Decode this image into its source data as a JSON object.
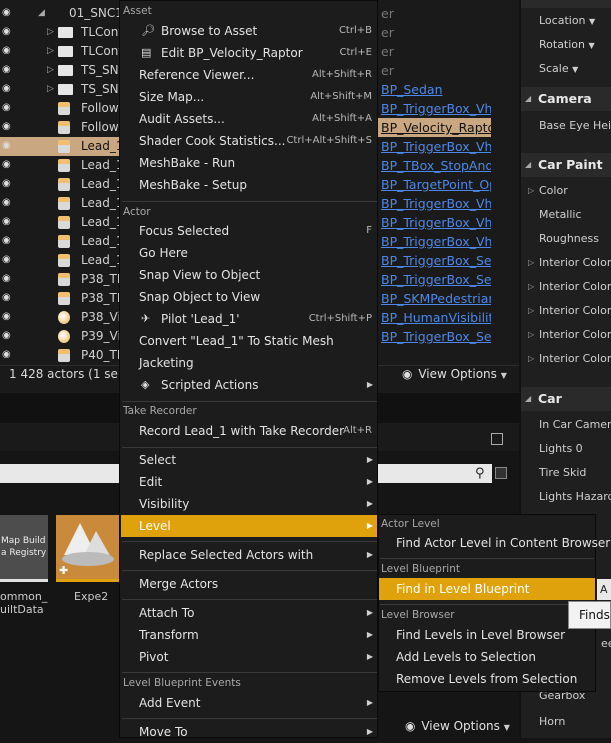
{
  "outliner": {
    "rows": [
      {
        "name": "01_SNC1",
        "kind": "folder-open"
      },
      {
        "name": "TLCont",
        "kind": "folder"
      },
      {
        "name": "TLCont",
        "kind": "folder"
      },
      {
        "name": "TS_SNC",
        "kind": "folder"
      },
      {
        "name": "TS_SNC",
        "kind": "folder"
      },
      {
        "name": "Followe",
        "kind": "actor"
      },
      {
        "name": "Followe",
        "kind": "actor"
      },
      {
        "name": "Lead_1",
        "kind": "actor",
        "selected": true
      },
      {
        "name": "Lead_1",
        "kind": "actor"
      },
      {
        "name": "Lead_1",
        "kind": "actor"
      },
      {
        "name": "Lead_1",
        "kind": "actor"
      },
      {
        "name": "Lead_1",
        "kind": "actor"
      },
      {
        "name": "Lead_1",
        "kind": "actor"
      },
      {
        "name": "Lead_1",
        "kind": "actor"
      },
      {
        "name": "P38_TE",
        "kind": "actor"
      },
      {
        "name": "P38_TE",
        "kind": "actor"
      },
      {
        "name": "P38_Vi",
        "kind": "sphere"
      },
      {
        "name": "P39_Vi",
        "kind": "sphere"
      },
      {
        "name": "P40_TE",
        "kind": "actor"
      }
    ],
    "type_column": [
      {
        "text": "er",
        "style": "gray"
      },
      {
        "text": "er",
        "style": "gray"
      },
      {
        "text": "er",
        "style": "gray"
      },
      {
        "text": "er",
        "style": "gray"
      },
      {
        "text": "BP_Sedan",
        "style": "link"
      },
      {
        "text": "BP_TriggerBox_Vhc",
        "style": "link"
      },
      {
        "text": "BP_Velocity_Raptor",
        "style": "sel"
      },
      {
        "text": "BP_TriggerBox_Vhc",
        "style": "link"
      },
      {
        "text": "BP_TBox_StopAndC",
        "style": "link"
      },
      {
        "text": "BP_TargetPoint_Op",
        "style": "link"
      },
      {
        "text": "BP_TriggerBox_Vhc",
        "style": "link"
      },
      {
        "text": "BP_TriggerBox_Vhc",
        "style": "link"
      },
      {
        "text": "BP_TriggerBox_Vhc",
        "style": "link"
      },
      {
        "text": "BP_TriggerBox_Set",
        "style": "link"
      },
      {
        "text": "BP_TriggerBox_Set",
        "style": "link"
      },
      {
        "text": "BP_SKMPedestrian",
        "style": "link"
      },
      {
        "text": "BP_HumanVisibility",
        "style": "link"
      },
      {
        "text": "BP_TriggerBox_Set",
        "style": "link"
      }
    ],
    "status": "1 428 actors (1 selec",
    "view_options": "View Options"
  },
  "context_menu": {
    "sections": {
      "asset": "Asset",
      "actor": "Actor",
      "take_recorder": "Take Recorder",
      "level_blueprint_events": "Level Blueprint Events"
    },
    "items": {
      "browse_to_asset": {
        "label": "Browse to Asset",
        "shortcut": "Ctrl+B"
      },
      "edit_bp": {
        "label": "Edit BP_Velocity_Raptor",
        "shortcut": "Ctrl+E"
      },
      "reference_viewer": {
        "label": "Reference Viewer...",
        "shortcut": "Alt+Shift+R"
      },
      "size_map": {
        "label": "Size Map...",
        "shortcut": "Alt+Shift+M"
      },
      "audit_assets": {
        "label": "Audit Assets...",
        "shortcut": "Alt+Shift+A"
      },
      "shader_cook": {
        "label": "Shader Cook Statistics...",
        "shortcut": "Ctrl+Alt+Shift+S"
      },
      "meshbake_run": {
        "label": "MeshBake - Run"
      },
      "meshbake_setup": {
        "label": "MeshBake - Setup"
      },
      "focus_selected": {
        "label": "Focus Selected",
        "shortcut": "F"
      },
      "go_here": {
        "label": "Go Here"
      },
      "snap_view": {
        "label": "Snap View to Object"
      },
      "snap_object": {
        "label": "Snap Object to View"
      },
      "pilot": {
        "label": "Pilot 'Lead_1'",
        "shortcut": "Ctrl+Shift+P"
      },
      "convert": {
        "label": "Convert \"Lead_1\" To Static Mesh"
      },
      "jacketing": {
        "label": "Jacketing"
      },
      "scripted_actions": {
        "label": "Scripted Actions"
      },
      "record": {
        "label": "Record Lead_1 with Take Recorder",
        "shortcut": "Alt+R"
      },
      "select": {
        "label": "Select"
      },
      "edit": {
        "label": "Edit"
      },
      "visibility": {
        "label": "Visibility"
      },
      "level": {
        "label": "Level"
      },
      "replace": {
        "label": "Replace Selected Actors with"
      },
      "merge": {
        "label": "Merge Actors"
      },
      "attach": {
        "label": "Attach To"
      },
      "transform": {
        "label": "Transform"
      },
      "pivot": {
        "label": "Pivot"
      },
      "add_event": {
        "label": "Add Event"
      },
      "move_to": {
        "label": "Move To"
      }
    }
  },
  "level_submenu": {
    "sections": {
      "actor_level": "Actor Level",
      "level_blueprint": "Level Blueprint",
      "level_browser": "Level Browser"
    },
    "items": {
      "find_actor_level": "Find Actor Level in Content Browser",
      "find_in_blueprint": "Find in Level Blueprint",
      "find_levels": "Find Levels in Level Browser",
      "add_levels": "Add Levels to Selection",
      "remove_levels": "Remove Levels from Selection"
    }
  },
  "tooltip": {
    "text": "Finds"
  },
  "tooltip_prefix": "A",
  "details_panel": {
    "transform_rows": [
      "Location",
      "Rotation",
      "Scale"
    ],
    "camera_header": "Camera",
    "camera_rows": [
      "Base Eye Heig"
    ],
    "car_paint_header": "Car Paint",
    "car_paint_rows": [
      {
        "label": "Color",
        "arrow": true
      },
      {
        "label": "Metallic",
        "arrow": false
      },
      {
        "label": "Roughness",
        "arrow": false
      },
      {
        "label": "Interior Color 1",
        "arrow": true
      },
      {
        "label": "Interior Color 2",
        "arrow": true
      },
      {
        "label": "Interior Color 3",
        "arrow": true
      },
      {
        "label": "Interior Color 4",
        "arrow": true
      },
      {
        "label": "Interior Color E",
        "arrow": true
      }
    ],
    "car_header": "Car",
    "car_rows": [
      "In Car Camera",
      "Lights 0",
      "Tire Skid",
      "Lights Hazard"
    ],
    "bottom_rows": [
      "Gearbox",
      "Horn"
    ],
    "partial_text": "ee"
  },
  "content_browser": {
    "tiles": [
      {
        "label": "ommon_\nuiltData",
        "thumb_text": "Map Build\na Registry"
      },
      {
        "label": "Expe2"
      }
    ],
    "view_options": "View Options"
  }
}
